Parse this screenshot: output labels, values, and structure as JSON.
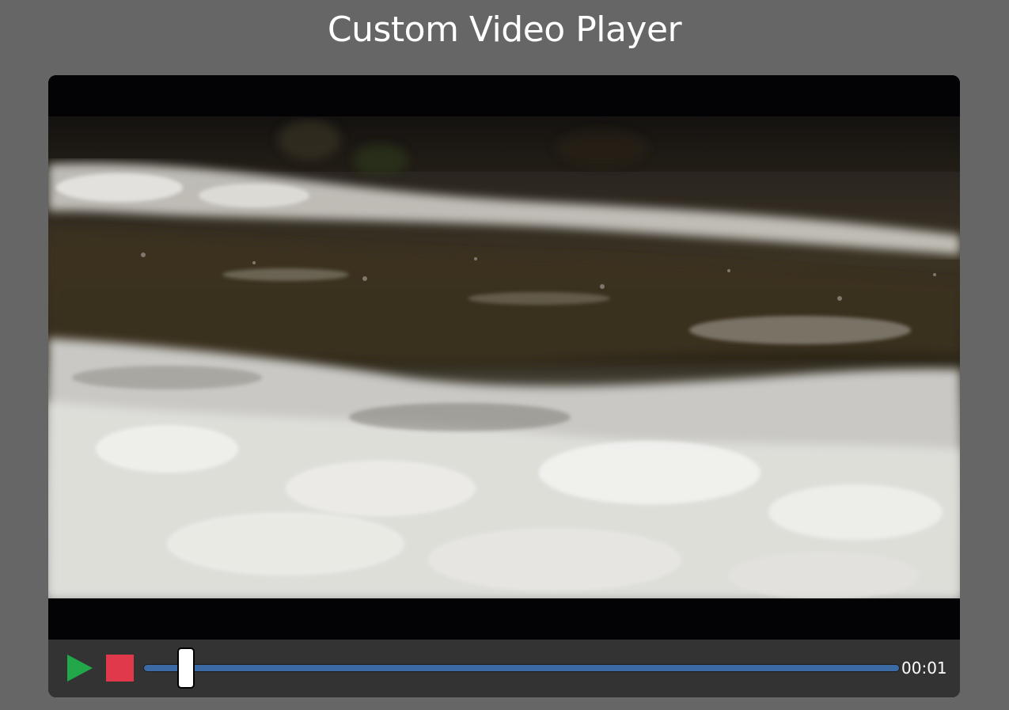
{
  "page": {
    "title": "Custom Video Player"
  },
  "player": {
    "controls": {
      "play_icon": "play-icon",
      "stop_icon": "stop-icon",
      "progress_fraction": 0.03,
      "timestamp": "00:01"
    },
    "colors": {
      "background": "#666666",
      "controls_bg": "#333333",
      "play": "#22a74a",
      "stop": "#e0394b",
      "progress": "#3b6aa5"
    }
  }
}
